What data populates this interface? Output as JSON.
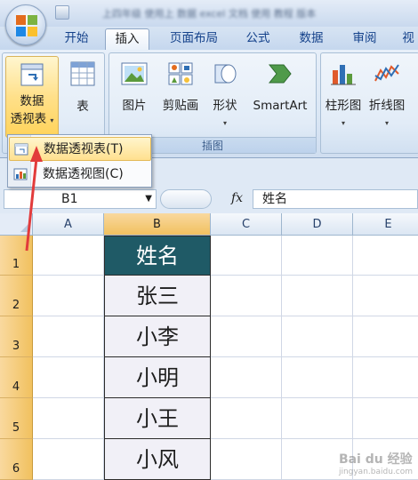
{
  "titlebar": {
    "blurred_title": "上四年级 使用上 数据 excel 文档 使用 教程 版本"
  },
  "tabs": [
    "开始",
    "插入",
    "页面布局",
    "公式",
    "数据",
    "审阅",
    "视"
  ],
  "active_tab": "插入",
  "ribbon": {
    "tables_group": {
      "pivot_label_1": "数据",
      "pivot_label_2": "透视表",
      "table_label": "表"
    },
    "illustrations_group": {
      "label": "插图",
      "picture": "图片",
      "clipart": "剪贴画",
      "shapes": "形状",
      "smartart": "SmartArt"
    },
    "charts_group": {
      "column": "柱形图",
      "line": "折线图"
    }
  },
  "dropdown_menu": {
    "items": [
      {
        "label": "数据透视表(T)"
      },
      {
        "label": "数据透视图(C)"
      }
    ]
  },
  "formula_bar": {
    "name_box": "B1",
    "fx": "fx",
    "content": "姓名"
  },
  "grid": {
    "columns": [
      "A",
      "B",
      "C",
      "D",
      "E"
    ],
    "selected_column": "B",
    "rows": [
      "1",
      "2",
      "3",
      "4",
      "5",
      "6"
    ],
    "column_b": [
      "姓名",
      "张三",
      "小李",
      "小明",
      "小王",
      "小风"
    ]
  },
  "colors": {
    "header_fill": "#1f5a66",
    "row_header": "#f1c15f",
    "annotation_arrow": "#e23b3b"
  },
  "watermark": {
    "brand": "Bai du 经验",
    "sub": "jingyan.baidu.com"
  }
}
